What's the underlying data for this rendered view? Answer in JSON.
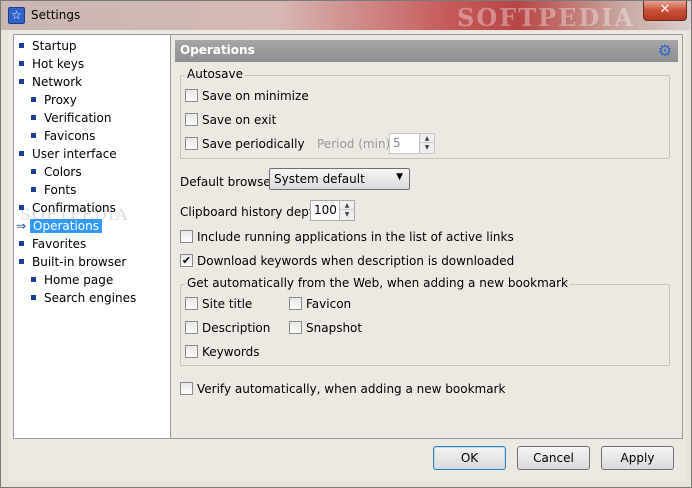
{
  "window": {
    "title": "Settings",
    "watermark": "SOFTPEDIA",
    "close_glyph": "✕"
  },
  "tree": {
    "watermark": "SOFTPEDIA",
    "items": [
      {
        "label": "Startup",
        "level": 0
      },
      {
        "label": "Hot keys",
        "level": 0
      },
      {
        "label": "Network",
        "level": 0
      },
      {
        "label": "Proxy",
        "level": 1
      },
      {
        "label": "Verification",
        "level": 1
      },
      {
        "label": "Favicons",
        "level": 1
      },
      {
        "label": "User interface",
        "level": 0
      },
      {
        "label": "Colors",
        "level": 1
      },
      {
        "label": "Fonts",
        "level": 1
      },
      {
        "label": "Confirmations",
        "level": 0
      },
      {
        "label": "Operations",
        "level": 0,
        "selected": true
      },
      {
        "label": "Favorites",
        "level": 0
      },
      {
        "label": "Built-in browser",
        "level": 0
      },
      {
        "label": "Home page",
        "level": 1
      },
      {
        "label": "Search engines",
        "level": 1
      }
    ]
  },
  "panel": {
    "title": "Operations",
    "autosave": {
      "label": "Autosave",
      "save_on_minimize": "Save on minimize",
      "save_on_exit": "Save on exit",
      "save_periodically": "Save periodically",
      "period_label": "Period (min)",
      "period_value": "5"
    },
    "default_browser_label": "Default browser",
    "default_browser_value": "System default",
    "clipboard_label": "Clipboard history depth",
    "clipboard_value": "100",
    "include_running": "Include running applications in the list of active links",
    "download_keywords": "Download keywords when description is downloaded",
    "web_group": {
      "label": "Get automatically from the Web, when adding a new bookmark",
      "site_title": "Site title",
      "favicon": "Favicon",
      "description": "Description",
      "snapshot": "Snapshot",
      "keywords": "Keywords"
    },
    "verify_auto": "Verify automatically, when adding a new bookmark"
  },
  "buttons": {
    "ok": "OK",
    "cancel": "Cancel",
    "apply": "Apply"
  },
  "colors": {
    "selection": "#3399ff",
    "header": "#9b9b9b",
    "gear": "#2d6ac8"
  },
  "glyphs": {
    "check": "✔",
    "spin_up": "▲",
    "spin_down": "▼",
    "dropdown": "▼",
    "arrow": "⇒",
    "gear": "⚙",
    "app": "☆"
  }
}
